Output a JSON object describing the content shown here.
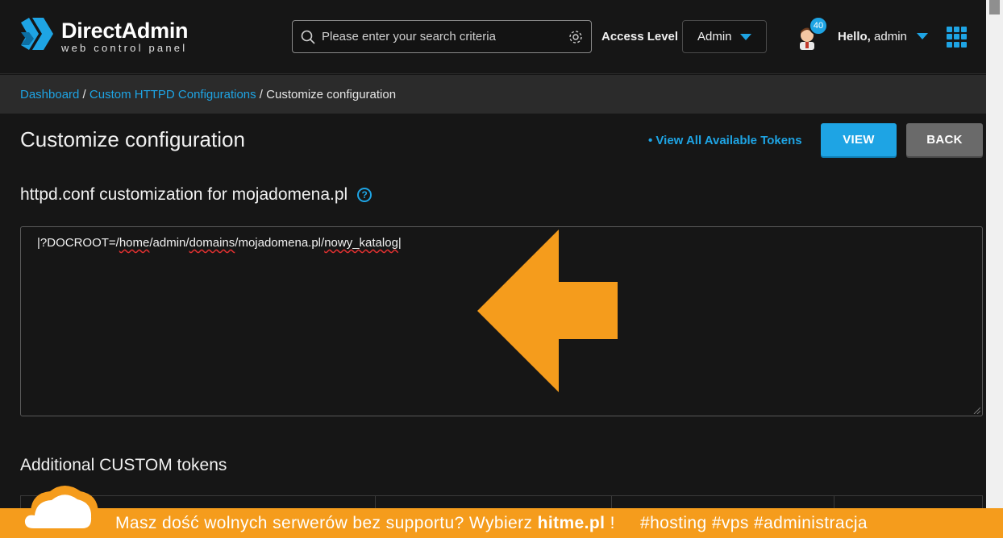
{
  "brand": {
    "title": "DirectAdmin",
    "subtitle": "web control panel"
  },
  "search": {
    "placeholder": "Please enter your search criteria"
  },
  "header": {
    "access_label": "Access Level",
    "access_value": "Admin",
    "notification_count": "40",
    "hello_prefix": "Hello,",
    "hello_user": "admin"
  },
  "breadcrumb": {
    "items": [
      "Dashboard",
      "Custom HTTPD Configurations"
    ],
    "separator": " / ",
    "current": "Customize configuration"
  },
  "page": {
    "title": "Customize configuration",
    "tokens_link": "• View All Available Tokens",
    "view_button": "VIEW",
    "back_button": "BACK",
    "section_title": "httpd.conf customization for mojadomena.pl",
    "help_glyph": "?",
    "additional_title": "Additional CUSTOM tokens"
  },
  "editor": {
    "segments": [
      "|?DOCROOT=/",
      "home",
      "/admin/",
      "domains",
      "/mojadomena.pl/",
      "nowy_katalog",
      "|"
    ]
  },
  "promo": {
    "text_before": "Masz dość wolnych serwerów bez supportu? Wybierz ",
    "brand": "hitme.pl",
    "text_after": " !     #hosting #vps #administracja"
  },
  "colors": {
    "accent": "#1ea4e4",
    "arrow": "#f59c1c",
    "banner": "#f59c1c",
    "background": "#161616"
  }
}
